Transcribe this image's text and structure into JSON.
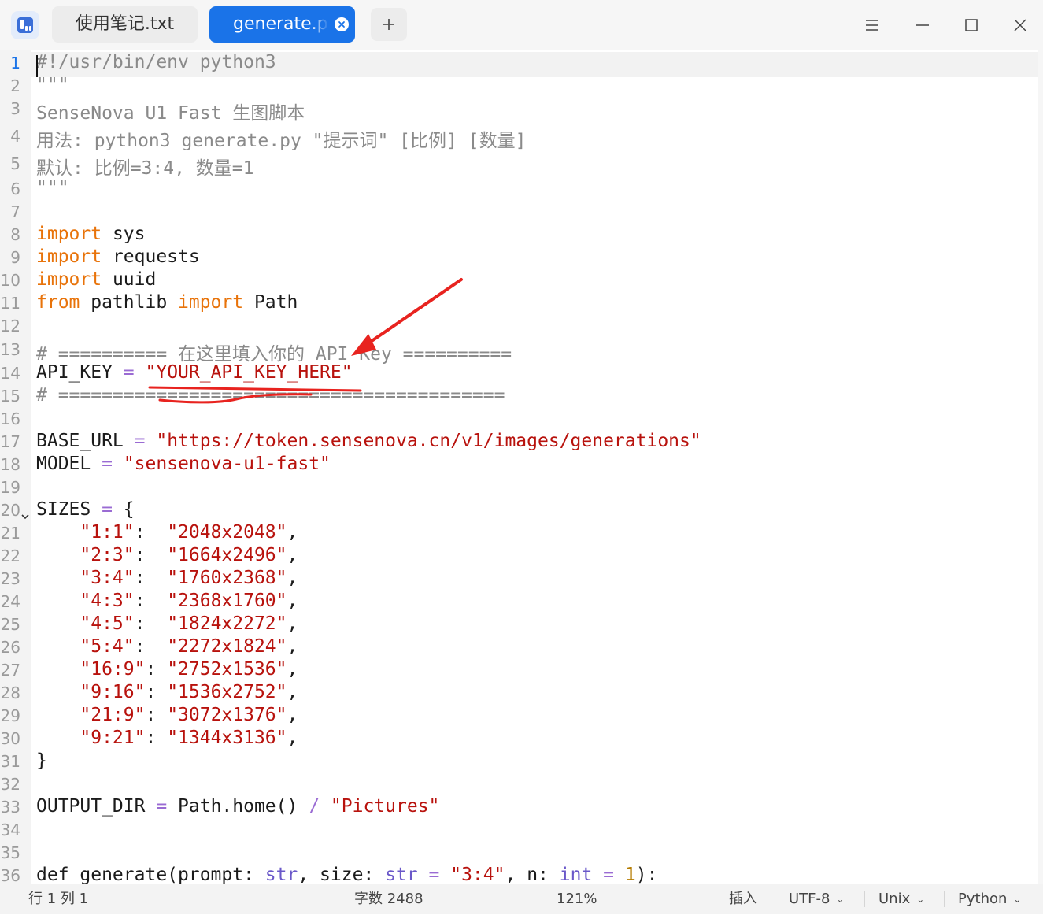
{
  "tabs": [
    {
      "label": "使用笔记.txt",
      "active": false
    },
    {
      "label": "generate.py",
      "active": true
    }
  ],
  "window_controls": [
    "menu-icon",
    "minimize-icon",
    "maximize-icon",
    "close-icon"
  ],
  "editor": {
    "language": "Python",
    "current_line": 1,
    "line_numbers": [
      "1",
      "2",
      "3",
      "4",
      "5",
      "6",
      "7",
      "8",
      "9",
      "10",
      "11",
      "12",
      "13",
      "14",
      "15",
      "16",
      "17",
      "18",
      "19",
      "20",
      "21",
      "22",
      "23",
      "24",
      "25",
      "26",
      "27",
      "28",
      "29",
      "30",
      "31",
      "32",
      "33",
      "34",
      "35",
      "36"
    ],
    "lines": [
      [
        {
          "t": "#!/usr/bin/env python3",
          "c": "cm"
        }
      ],
      [
        {
          "t": "\"\"\"",
          "c": "cm"
        }
      ],
      [
        {
          "t": "SenseNova U1 Fast 生图脚本",
          "c": "cm"
        }
      ],
      [
        {
          "t": "用法: python3 generate.py \"提示词\" [比例] [数量]",
          "c": "cm"
        }
      ],
      [
        {
          "t": "默认: 比例=3:4, 数量=1",
          "c": "cm"
        }
      ],
      [
        {
          "t": "\"\"\"",
          "c": "cm"
        }
      ],
      [],
      [
        {
          "t": "import",
          "c": "kw"
        },
        {
          "t": " sys",
          "c": ""
        }
      ],
      [
        {
          "t": "import",
          "c": "kw"
        },
        {
          "t": " requests",
          "c": ""
        }
      ],
      [
        {
          "t": "import",
          "c": "kw"
        },
        {
          "t": " uuid",
          "c": ""
        }
      ],
      [
        {
          "t": "from",
          "c": "kw"
        },
        {
          "t": " pathlib ",
          "c": ""
        },
        {
          "t": "import",
          "c": "kw"
        },
        {
          "t": " Path",
          "c": ""
        }
      ],
      [],
      [
        {
          "t": "# ========== 在这里填入你的 API Key ==========",
          "c": "cm"
        }
      ],
      [
        {
          "t": "API_KEY ",
          "c": ""
        },
        {
          "t": "=",
          "c": "op"
        },
        {
          "t": " ",
          "c": ""
        },
        {
          "t": "\"YOUR_API_KEY_HERE\"",
          "c": "str"
        }
      ],
      [
        {
          "t": "# =========================================",
          "c": "cm"
        }
      ],
      [],
      [
        {
          "t": "BASE_URL ",
          "c": ""
        },
        {
          "t": "=",
          "c": "op"
        },
        {
          "t": " ",
          "c": ""
        },
        {
          "t": "\"https://token.sensenova.cn/v1/images/generations\"",
          "c": "str"
        }
      ],
      [
        {
          "t": "MODEL ",
          "c": ""
        },
        {
          "t": "=",
          "c": "op"
        },
        {
          "t": " ",
          "c": ""
        },
        {
          "t": "\"sensenova-u1-fast\"",
          "c": "str"
        }
      ],
      [],
      [
        {
          "t": "SIZES ",
          "c": ""
        },
        {
          "t": "=",
          "c": "op"
        },
        {
          "t": " {",
          "c": ""
        }
      ],
      [
        {
          "t": "    ",
          "c": ""
        },
        {
          "t": "\"1:1\"",
          "c": "str"
        },
        {
          "t": ":  ",
          "c": ""
        },
        {
          "t": "\"2048x2048\"",
          "c": "str"
        },
        {
          "t": ",",
          "c": ""
        }
      ],
      [
        {
          "t": "    ",
          "c": ""
        },
        {
          "t": "\"2:3\"",
          "c": "str"
        },
        {
          "t": ":  ",
          "c": ""
        },
        {
          "t": "\"1664x2496\"",
          "c": "str"
        },
        {
          "t": ",",
          "c": ""
        }
      ],
      [
        {
          "t": "    ",
          "c": ""
        },
        {
          "t": "\"3:4\"",
          "c": "str"
        },
        {
          "t": ":  ",
          "c": ""
        },
        {
          "t": "\"1760x2368\"",
          "c": "str"
        },
        {
          "t": ",",
          "c": ""
        }
      ],
      [
        {
          "t": "    ",
          "c": ""
        },
        {
          "t": "\"4:3\"",
          "c": "str"
        },
        {
          "t": ":  ",
          "c": ""
        },
        {
          "t": "\"2368x1760\"",
          "c": "str"
        },
        {
          "t": ",",
          "c": ""
        }
      ],
      [
        {
          "t": "    ",
          "c": ""
        },
        {
          "t": "\"4:5\"",
          "c": "str"
        },
        {
          "t": ":  ",
          "c": ""
        },
        {
          "t": "\"1824x2272\"",
          "c": "str"
        },
        {
          "t": ",",
          "c": ""
        }
      ],
      [
        {
          "t": "    ",
          "c": ""
        },
        {
          "t": "\"5:4\"",
          "c": "str"
        },
        {
          "t": ":  ",
          "c": ""
        },
        {
          "t": "\"2272x1824\"",
          "c": "str"
        },
        {
          "t": ",",
          "c": ""
        }
      ],
      [
        {
          "t": "    ",
          "c": ""
        },
        {
          "t": "\"16:9\"",
          "c": "str"
        },
        {
          "t": ": ",
          "c": ""
        },
        {
          "t": "\"2752x1536\"",
          "c": "str"
        },
        {
          "t": ",",
          "c": ""
        }
      ],
      [
        {
          "t": "    ",
          "c": ""
        },
        {
          "t": "\"9:16\"",
          "c": "str"
        },
        {
          "t": ": ",
          "c": ""
        },
        {
          "t": "\"1536x2752\"",
          "c": "str"
        },
        {
          "t": ",",
          "c": ""
        }
      ],
      [
        {
          "t": "    ",
          "c": ""
        },
        {
          "t": "\"21:9\"",
          "c": "str"
        },
        {
          "t": ": ",
          "c": ""
        },
        {
          "t": "\"3072x1376\"",
          "c": "str"
        },
        {
          "t": ",",
          "c": ""
        }
      ],
      [
        {
          "t": "    ",
          "c": ""
        },
        {
          "t": "\"9:21\"",
          "c": "str"
        },
        {
          "t": ": ",
          "c": ""
        },
        {
          "t": "\"1344x3136\"",
          "c": "str"
        },
        {
          "t": ",",
          "c": ""
        }
      ],
      [
        {
          "t": "}",
          "c": ""
        }
      ],
      [],
      [
        {
          "t": "OUTPUT_DIR ",
          "c": ""
        },
        {
          "t": "=",
          "c": "op"
        },
        {
          "t": " Path.home() ",
          "c": ""
        },
        {
          "t": "/",
          "c": "op"
        },
        {
          "t": " ",
          "c": ""
        },
        {
          "t": "\"Pictures\"",
          "c": "str"
        }
      ],
      [],
      [],
      [
        {
          "t": "def generate(prompt: ",
          "c": ""
        },
        {
          "t": "str",
          "c": "ty"
        },
        {
          "t": ", size: ",
          "c": ""
        },
        {
          "t": "str",
          "c": "ty"
        },
        {
          "t": " ",
          "c": ""
        },
        {
          "t": "=",
          "c": "op"
        },
        {
          "t": " ",
          "c": ""
        },
        {
          "t": "\"3:4\"",
          "c": "str"
        },
        {
          "t": ", n: ",
          "c": ""
        },
        {
          "t": "int",
          "c": "ty"
        },
        {
          "t": " ",
          "c": ""
        },
        {
          "t": "=",
          "c": "op"
        },
        {
          "t": " ",
          "c": ""
        },
        {
          "t": "1",
          "c": "num"
        },
        {
          "t": "):",
          "c": ""
        }
      ]
    ]
  },
  "status": {
    "position": "行 1  列 1",
    "char_count": "字数 2488",
    "zoom": "121%",
    "mode": "插入",
    "encoding": "UTF-8",
    "line_ending": "Unix",
    "language": "Python"
  },
  "colors": {
    "accent": "#1a73e8",
    "keyword": "#e8730a",
    "string": "#b8120d",
    "comment": "#8a8a8a",
    "annotation": "#e8231f"
  }
}
